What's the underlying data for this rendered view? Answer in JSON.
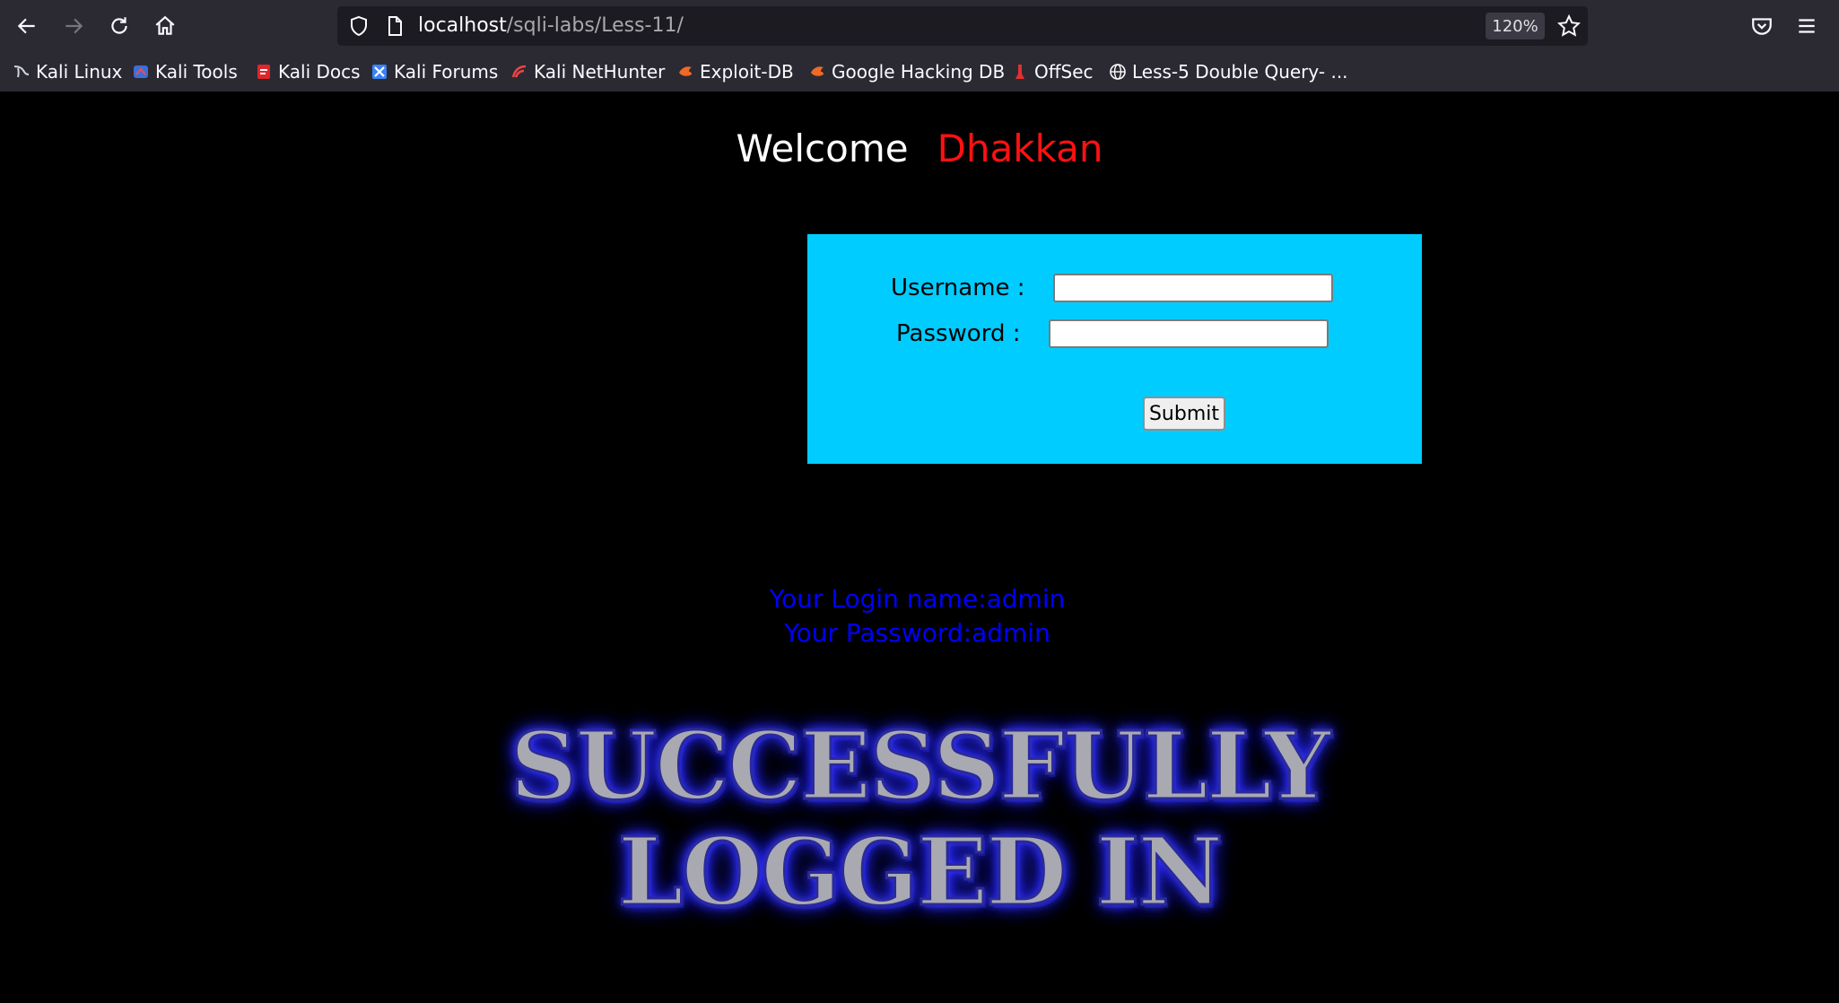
{
  "browser": {
    "url_host": "localhost",
    "url_path": "/sqli-labs/Less-11/",
    "zoom": "120%",
    "bookmarks": [
      {
        "label": "Kali Linux",
        "icon": "kali-dragon-icon"
      },
      {
        "label": "Kali Tools",
        "icon": "kali-tools-icon"
      },
      {
        "label": "Kali Docs",
        "icon": "kali-docs-icon"
      },
      {
        "label": "Kali Forums",
        "icon": "kali-forums-icon"
      },
      {
        "label": "Kali NetHunter",
        "icon": "nethunter-icon"
      },
      {
        "label": "Exploit-DB",
        "icon": "exploit-db-icon"
      },
      {
        "label": "Google Hacking DB",
        "icon": "ghdb-icon"
      },
      {
        "label": "OffSec",
        "icon": "offsec-icon"
      },
      {
        "label": "Less-5 Double Query- ...",
        "icon": "globe-icon"
      }
    ]
  },
  "page": {
    "welcome": "Welcome",
    "name": "Dhakkan",
    "username_label": "Username :",
    "password_label": "Password :",
    "username_value": "",
    "password_value": "",
    "submit_label": "Submit",
    "login_name_line": "Your Login name:admin",
    "password_line": "Your Password:admin",
    "success_line1": "SUCCESSFULLY",
    "success_line2": "LOGGED IN"
  },
  "colors": {
    "page_bg": "#000000",
    "box_bg": "#00ccff",
    "name_red": "#ff1111",
    "info_blue": "#0000ff",
    "chrome_bg": "#2b2a33"
  }
}
